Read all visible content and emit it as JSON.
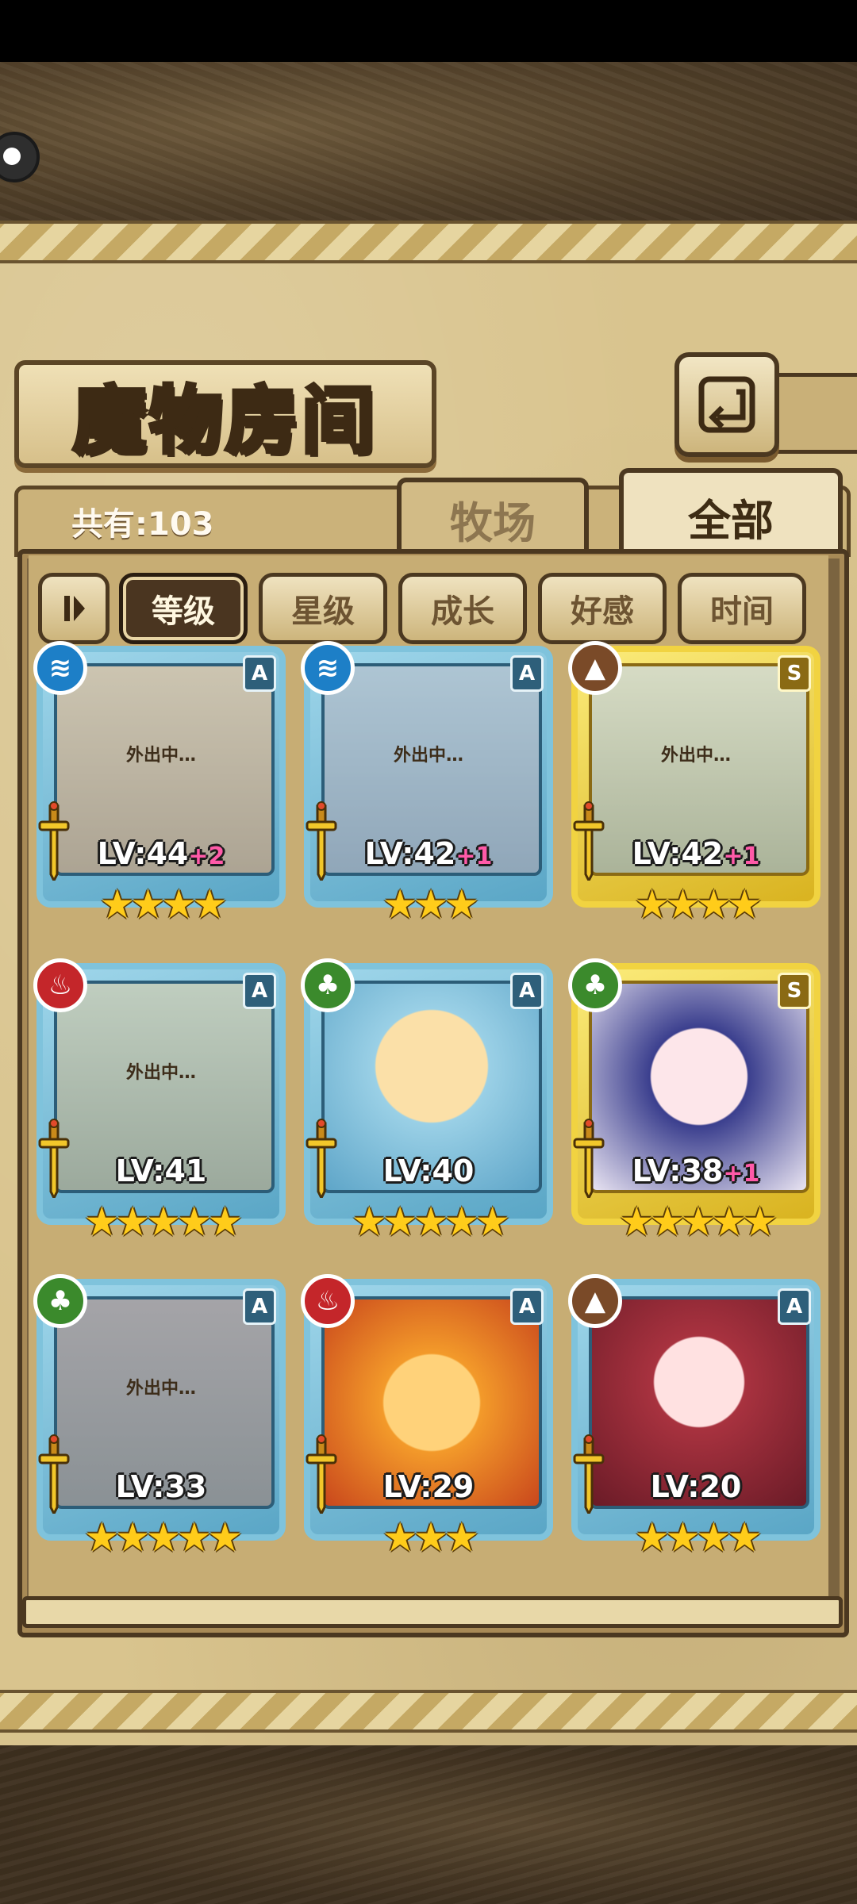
{
  "header": {
    "title": "魔物房间",
    "back_icon": "return-arrow-icon"
  },
  "tabs": {
    "count_text": "共有:103",
    "ranch": "牧场",
    "all": "全部"
  },
  "sort": {
    "toggle_icon": "sort-order-icon",
    "buttons": [
      "等级",
      "星级",
      "成长",
      "好感",
      "时间"
    ],
    "active_index": 0
  },
  "monsters": [
    {
      "element": "water",
      "rank": "A",
      "level": "LV:44",
      "plus": "+2",
      "stars": 4,
      "away": true,
      "away_label": "外出中…",
      "frame": "blue"
    },
    {
      "element": "water",
      "rank": "A",
      "level": "LV:42",
      "plus": "+1",
      "stars": 3,
      "away": true,
      "away_label": "外出中…",
      "frame": "blue"
    },
    {
      "element": "earth",
      "rank": "S",
      "level": "LV:42",
      "plus": "+1",
      "stars": 4,
      "away": true,
      "away_label": "外出中…",
      "frame": "gold"
    },
    {
      "element": "fire",
      "rank": "A",
      "level": "LV:41",
      "plus": "",
      "stars": 5,
      "away": true,
      "away_label": "外出中…",
      "frame": "blue"
    },
    {
      "element": "leaf",
      "rank": "A",
      "level": "LV:40",
      "plus": "",
      "stars": 5,
      "away": false,
      "away_label": "",
      "frame": "blue"
    },
    {
      "element": "leaf",
      "rank": "S",
      "level": "LV:38",
      "plus": "+1",
      "stars": 5,
      "away": false,
      "away_label": "",
      "frame": "gold"
    },
    {
      "element": "leaf",
      "rank": "A",
      "level": "LV:33",
      "plus": "",
      "stars": 5,
      "away": true,
      "away_label": "外出中…",
      "frame": "blue"
    },
    {
      "element": "fire",
      "rank": "A",
      "level": "LV:29",
      "plus": "",
      "stars": 3,
      "away": false,
      "away_label": "",
      "frame": "blue"
    },
    {
      "element": "earth",
      "rank": "A",
      "level": "LV:20",
      "plus": "",
      "stars": 4,
      "away": false,
      "away_label": "",
      "frame": "blue"
    }
  ],
  "colors": {
    "water": "#1d7fc7",
    "fire": "#c4262a",
    "leaf": "#3b8a2c",
    "earth": "#7a4a28",
    "frame_blue": "#7fc3dc",
    "frame_gold": "#f1d341",
    "plus_pink": "#ff5aa8"
  }
}
